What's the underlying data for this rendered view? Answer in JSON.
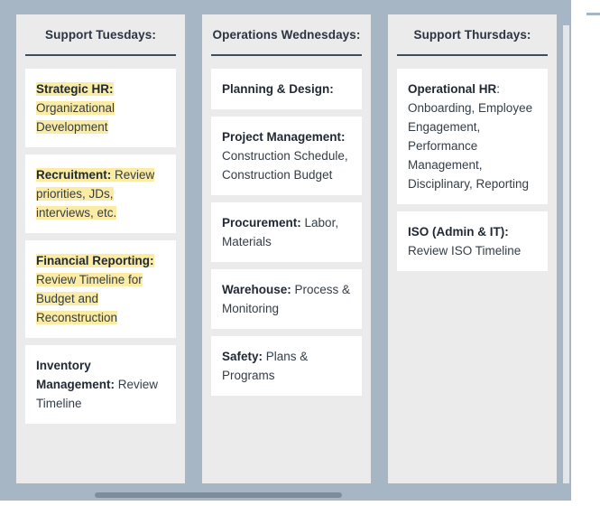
{
  "board": {
    "frame_color": "#a7b6c4",
    "column_bg": "#ebebeb",
    "card_bg": "#ffffff",
    "highlight_color": "#fbeca5",
    "header_rule_color": "#3d4f5f",
    "text_color": "#333d47"
  },
  "columns": [
    {
      "header": "Support Tuesdays:",
      "cards": [
        {
          "highlighted": true,
          "segments": [
            {
              "text": "Strategic HR:",
              "bold": true,
              "highlight": true
            },
            {
              "text": " Organizational Development",
              "bold": false,
              "highlight": true
            }
          ]
        },
        {
          "highlighted": true,
          "segments": [
            {
              "text": "Recruitment:",
              "bold": true,
              "highlight": true
            },
            {
              "text": " Review priorities, JDs, interviews, etc.",
              "bold": false,
              "highlight": true
            }
          ]
        },
        {
          "highlighted": true,
          "segments": [
            {
              "text": "Financial Reporting:",
              "bold": true,
              "highlight": true
            },
            {
              "text": " Review Timeline for Budget and Reconstruction",
              "bold": false,
              "highlight": true
            }
          ]
        },
        {
          "highlighted": false,
          "segments": [
            {
              "text": "Inventory Management:",
              "bold": true,
              "highlight": false
            },
            {
              "text": " Review Timeline",
              "bold": false,
              "highlight": false
            }
          ]
        }
      ]
    },
    {
      "header": "Operations Wednesdays:",
      "cards": [
        {
          "highlighted": false,
          "segments": [
            {
              "text": "Planning & Design:",
              "bold": true,
              "highlight": false
            }
          ]
        },
        {
          "highlighted": false,
          "segments": [
            {
              "text": "Project Management:",
              "bold": true,
              "highlight": false
            },
            {
              "text": " Construction Schedule, Construction Budget",
              "bold": false,
              "highlight": false
            }
          ]
        },
        {
          "highlighted": false,
          "segments": [
            {
              "text": "Procurement:",
              "bold": true,
              "highlight": false
            },
            {
              "text": " Labor, Materials",
              "bold": false,
              "highlight": false
            }
          ]
        },
        {
          "highlighted": false,
          "segments": [
            {
              "text": "Warehouse:",
              "bold": true,
              "highlight": false
            },
            {
              "text": " Process & Monitoring",
              "bold": false,
              "highlight": false
            }
          ]
        },
        {
          "highlighted": false,
          "segments": [
            {
              "text": "Safety:",
              "bold": true,
              "highlight": false
            },
            {
              "text": " Plans & Programs",
              "bold": false,
              "highlight": false
            }
          ]
        }
      ]
    },
    {
      "header": "Support Thursdays:",
      "cards": [
        {
          "highlighted": false,
          "segments": [
            {
              "text": "Operational HR",
              "bold": true,
              "highlight": false
            },
            {
              "text": ": Onboarding, Employee Engagement, Performance Management, Disciplinary, Reporting",
              "bold": false,
              "highlight": false
            }
          ]
        },
        {
          "highlighted": false,
          "segments": [
            {
              "text": "ISO (Admin & IT):",
              "bold": true,
              "highlight": false
            },
            {
              "text": " Review ISO Timeline",
              "bold": false,
              "highlight": false
            }
          ]
        }
      ]
    }
  ],
  "scrollbars": {
    "horizontal": {
      "thumb_color": "#7e8d9c",
      "track_color": "#a7b6c4"
    },
    "vertical": {
      "track_color": "#e2e6ea"
    }
  }
}
